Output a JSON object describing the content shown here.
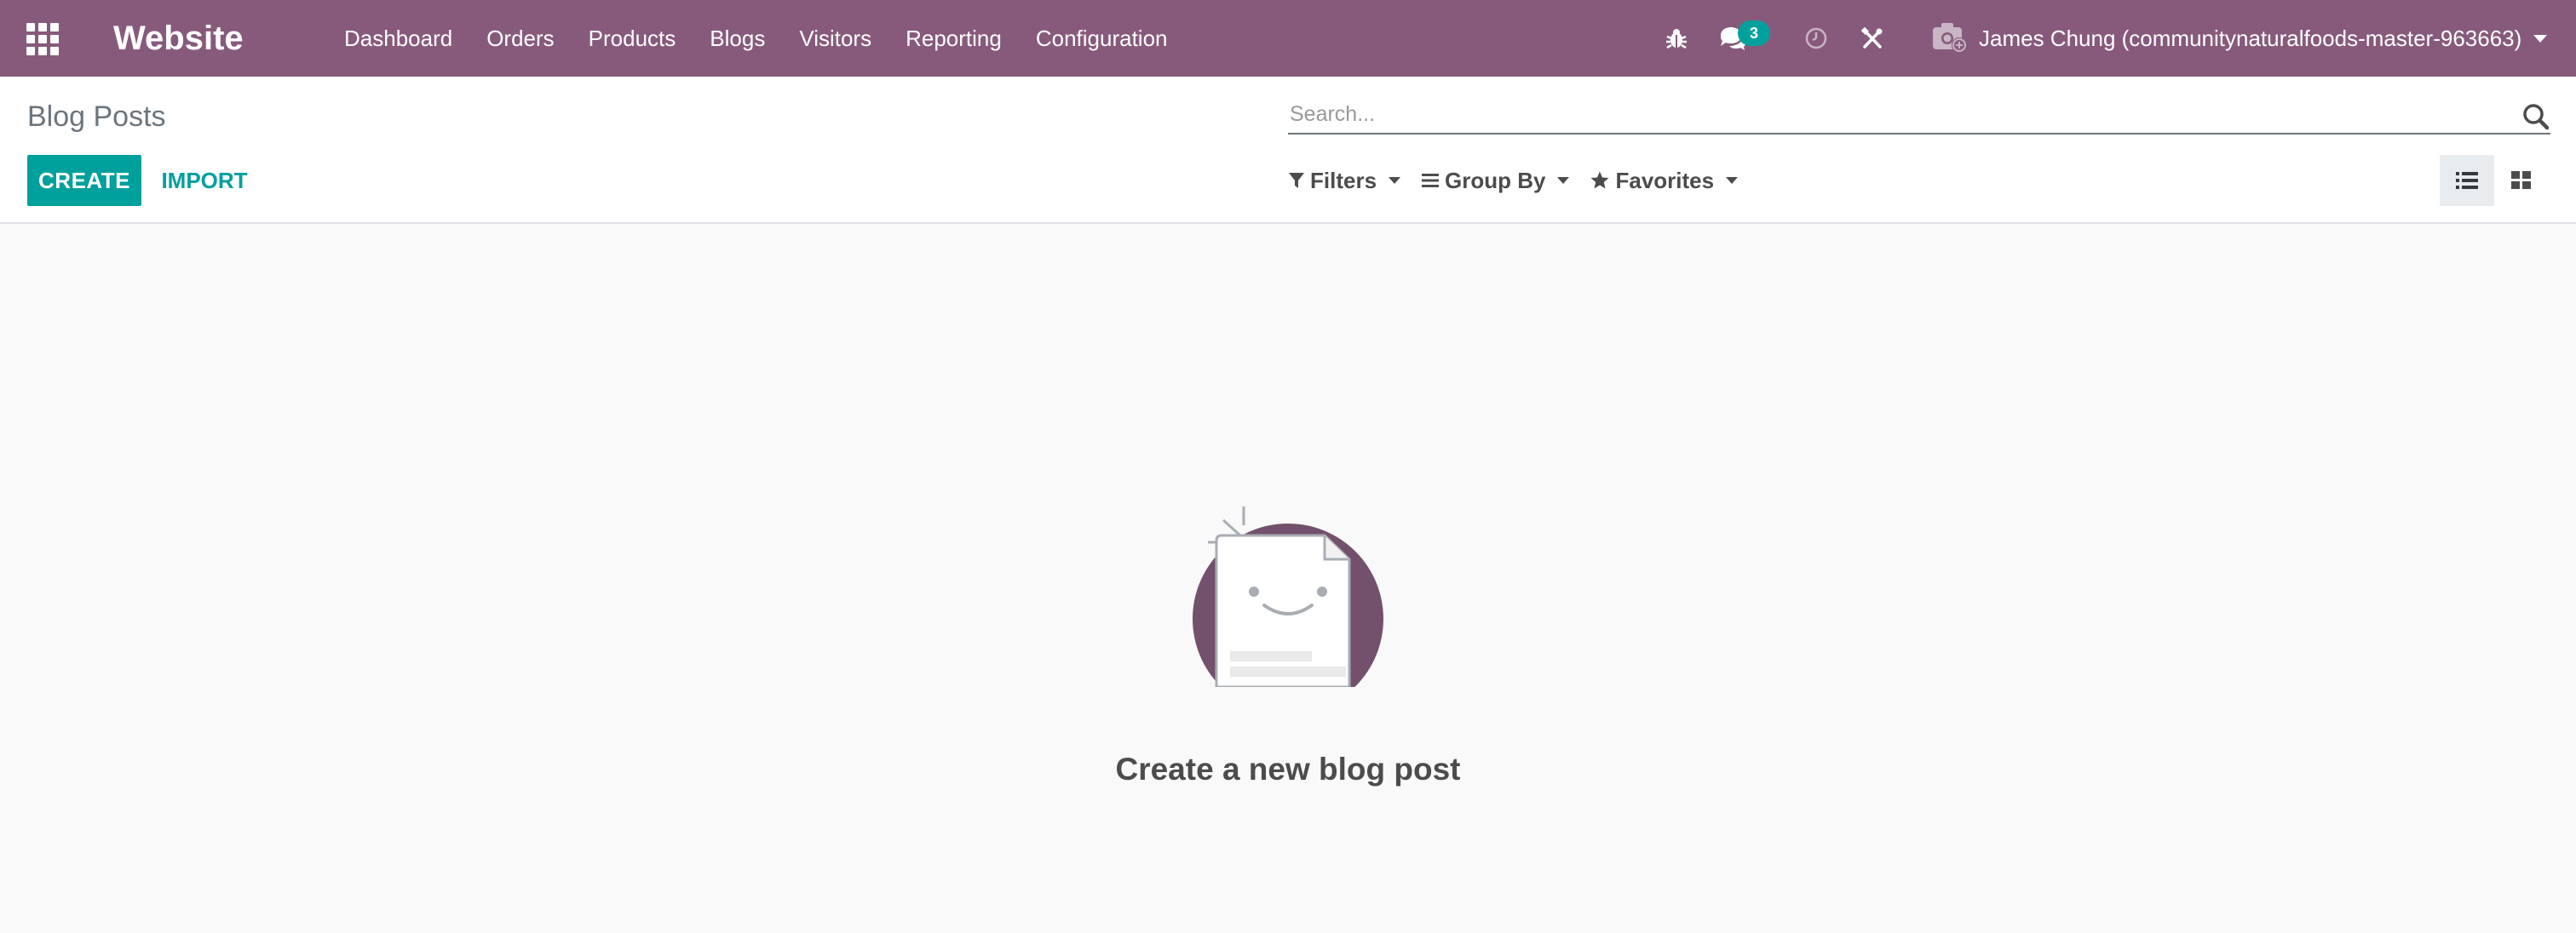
{
  "navbar": {
    "app_title": "Website",
    "menu": [
      {
        "label": "Dashboard"
      },
      {
        "label": "Orders"
      },
      {
        "label": "Products"
      },
      {
        "label": "Blogs"
      },
      {
        "label": "Visitors"
      },
      {
        "label": "Reporting"
      },
      {
        "label": "Configuration"
      }
    ],
    "messages_count": "3",
    "user_name": "James Chung (communitynaturalfoods-master-963663)",
    "colors": {
      "brand": "#875a7b",
      "accent": "#00a09d"
    },
    "icons": [
      "apps-grid-icon",
      "bug-icon",
      "chat-icon",
      "clock-icon",
      "tools-icon",
      "camera-icon"
    ]
  },
  "control_panel": {
    "breadcrumb": "Blog Posts",
    "search_placeholder": "Search...",
    "create_label": "CREATE",
    "import_label": "IMPORT",
    "filters_label": "Filters",
    "group_by_label": "Group By",
    "favorites_label": "Favorites",
    "views": [
      "list-view-icon",
      "kanban-view-icon"
    ],
    "active_view": "list"
  },
  "content": {
    "empty_title": "Create a new blog post"
  }
}
